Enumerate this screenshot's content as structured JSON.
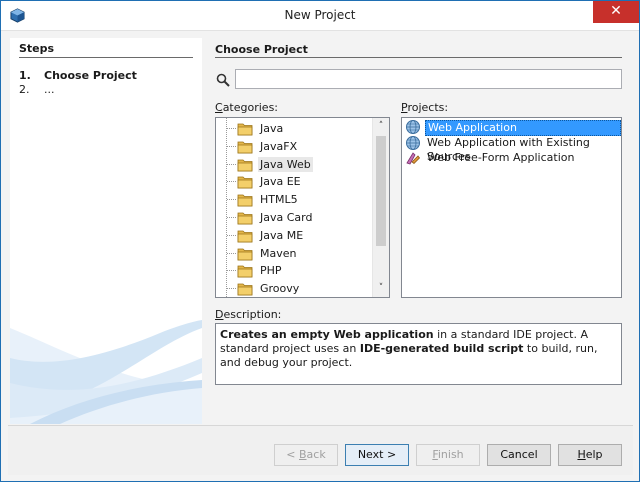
{
  "window": {
    "title": "New Project",
    "close_glyph": "✕",
    "app_icon": "netbeans-cube-icon"
  },
  "steps": {
    "title": "Steps",
    "items": [
      {
        "num": "1.",
        "label": "Choose Project",
        "active": true
      },
      {
        "num": "2.",
        "label": "...",
        "active": false
      }
    ]
  },
  "main": {
    "title": "Choose Project",
    "search": {
      "value": "",
      "placeholder": ""
    },
    "categories_label": {
      "u": "C",
      "rest": "ategories:"
    },
    "projects_label": {
      "u": "P",
      "rest": "rojects:"
    },
    "description_label": {
      "u": "D",
      "rest": "escription:"
    },
    "categories": [
      {
        "label": "Java"
      },
      {
        "label": "JavaFX"
      },
      {
        "label": "Java Web",
        "selected": true
      },
      {
        "label": "Java EE"
      },
      {
        "label": "HTML5"
      },
      {
        "label": "Java Card"
      },
      {
        "label": "Java ME"
      },
      {
        "label": "Maven"
      },
      {
        "label": "PHP"
      },
      {
        "label": "Groovy"
      }
    ],
    "projects": [
      {
        "label": "Web Application",
        "icon": "globe-icon",
        "selected": true
      },
      {
        "label": "Web Application with Existing Sources",
        "icon": "globe-icon"
      },
      {
        "label": "Web Free-Form Application",
        "icon": "freeform-icon"
      }
    ],
    "description": {
      "bold1": "Creates an empty Web application",
      "text1": " in a standard IDE project. A standard project uses an ",
      "bold2": "IDE-generated build script",
      "text2": " to build, run, and debug your project."
    }
  },
  "buttons": {
    "back": {
      "pre": "< ",
      "u": "B",
      "rest": "ack",
      "enabled": false
    },
    "next": {
      "label": "Next >",
      "enabled": true
    },
    "finish": {
      "pre": "",
      "u": "F",
      "rest": "inish",
      "enabled": false
    },
    "cancel": {
      "label": "Cancel",
      "enabled": true
    },
    "help": {
      "pre": "",
      "u": "H",
      "rest": "elp",
      "enabled": true
    }
  },
  "colors": {
    "selection": "#3399ff",
    "close_button": "#c7302b",
    "window_border": "#1f6fb3"
  }
}
